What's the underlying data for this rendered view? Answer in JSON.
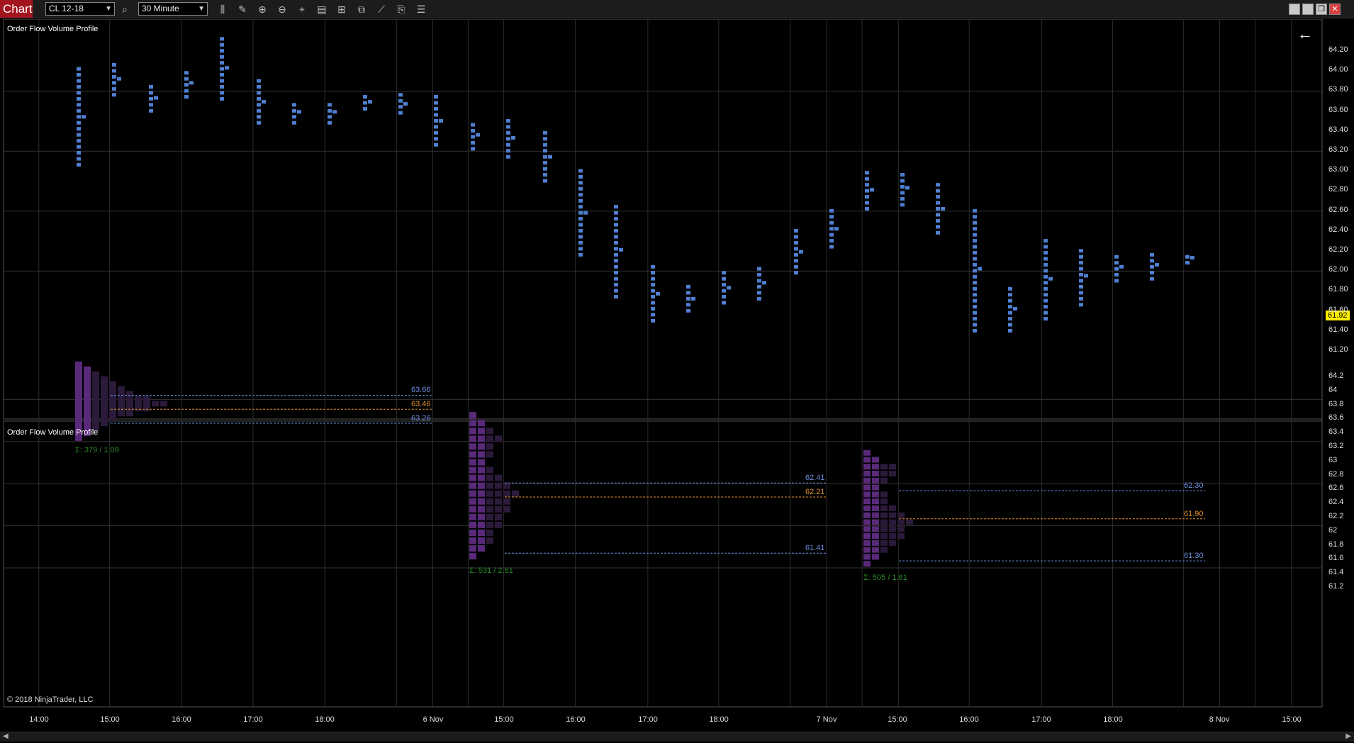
{
  "toolbar": {
    "tab_label": "Chart",
    "instrument": "CL 12-18",
    "interval": "30 Minute",
    "icons": [
      "search-icon",
      "bar-type-icon",
      "pencil-icon",
      "zoom-in-icon",
      "zoom-out-icon",
      "crosshair-icon",
      "data-box-icon",
      "properties-icon",
      "strategies-icon",
      "indicators-icon",
      "drawing-objects-icon"
    ],
    "window_buttons": [
      "minimize-icon",
      "restore-icon",
      "maximize-icon",
      "close-icon"
    ]
  },
  "colors": {
    "accent_red": "#a3141f",
    "tpo_blue": "#4f7fd1",
    "profile_purple": "#5a2a7a",
    "profile_dark": "#2b1a3a",
    "value_area_line": "#6a8ee0",
    "poc_line": "#e0902a",
    "price_badge": "#ffee00",
    "total_green": "#2a8a2a"
  },
  "upper_panel": {
    "title": "Order Flow Volume Profile",
    "last_price": "61.92",
    "y_ticks": [
      "64.20",
      "64.00",
      "63.80",
      "63.60",
      "63.40",
      "63.20",
      "63.00",
      "62.80",
      "62.60",
      "62.40",
      "62.20",
      "62.00",
      "61.80",
      "61.60",
      "61.40",
      "61.20"
    ]
  },
  "lower_panel": {
    "title": "Order Flow Volume Profile",
    "copyright": "© 2018 NinjaTrader, LLC",
    "y_ticks": [
      "64.2",
      "64",
      "63.8",
      "63.6",
      "63.4",
      "63.2",
      "63",
      "62.8",
      "62.6",
      "62.4",
      "62.2",
      "62",
      "61.8",
      "61.6",
      "61.4",
      "61.2"
    ],
    "sessions": [
      {
        "vah": "63.66",
        "poc": "63.46",
        "val": "63.26",
        "total": "Σ: 379 / 1.09"
      },
      {
        "vah": "62.41",
        "poc": "62.21",
        "val": "61.41",
        "total": "Σ: 531 / 2.61"
      },
      {
        "vah": "62.30",
        "poc": "61.90",
        "val": "61.30",
        "total": "Σ: 505 / 1.61"
      }
    ]
  },
  "x_axis": [
    "14:00",
    "15:00",
    "16:00",
    "17:00",
    "18:00",
    "6 Nov",
    "15:00",
    "16:00",
    "17:00",
    "18:00",
    "7 Nov",
    "15:00",
    "16:00",
    "17:00",
    "18:00",
    "8 Nov",
    "15:00"
  ],
  "chart_data": {
    "type": "profile",
    "instrument": "CL 12-18",
    "interval": "30 Minute",
    "tpo_ranges": [
      {
        "low": 62.86,
        "high": 63.82
      },
      {
        "low": 63.56,
        "high": 63.88
      },
      {
        "low": 63.4,
        "high": 63.66
      },
      {
        "low": 63.54,
        "high": 63.82
      },
      {
        "low": 63.52,
        "high": 64.14
      },
      {
        "low": 63.28,
        "high": 63.7
      },
      {
        "low": 63.28,
        "high": 63.5
      },
      {
        "low": 63.28,
        "high": 63.5
      },
      {
        "low": 63.42,
        "high": 63.56
      },
      {
        "low": 63.38,
        "high": 63.56
      },
      {
        "low": 63.06,
        "high": 63.54
      },
      {
        "low": 63.02,
        "high": 63.3
      },
      {
        "low": 62.94,
        "high": 63.32
      },
      {
        "low": 62.7,
        "high": 63.18
      },
      {
        "low": 61.96,
        "high": 62.8
      },
      {
        "low": 61.54,
        "high": 62.48
      },
      {
        "low": 61.3,
        "high": 61.84
      },
      {
        "low": 61.4,
        "high": 61.64
      },
      {
        "low": 61.48,
        "high": 61.78
      },
      {
        "low": 61.52,
        "high": 61.84
      },
      {
        "low": 61.78,
        "high": 62.2
      },
      {
        "low": 62.04,
        "high": 62.4
      },
      {
        "low": 62.42,
        "high": 62.8
      },
      {
        "low": 62.46,
        "high": 62.8
      },
      {
        "low": 62.18,
        "high": 62.66
      },
      {
        "low": 61.2,
        "high": 62.44
      },
      {
        "low": 61.2,
        "high": 61.64
      },
      {
        "low": 61.32,
        "high": 62.12
      },
      {
        "low": 61.46,
        "high": 62.04
      },
      {
        "low": 61.7,
        "high": 61.98
      },
      {
        "low": 61.72,
        "high": 62.0
      },
      {
        "low": 61.88,
        "high": 61.98
      }
    ],
    "sessions": [
      {
        "vah": 63.66,
        "poc": 63.46,
        "val": 63.26,
        "volume": 379
      },
      {
        "vah": 62.41,
        "poc": 62.21,
        "val": 61.41,
        "volume": 531
      },
      {
        "vah": 62.3,
        "poc": 61.9,
        "val": 61.3,
        "volume": 505
      }
    ]
  }
}
